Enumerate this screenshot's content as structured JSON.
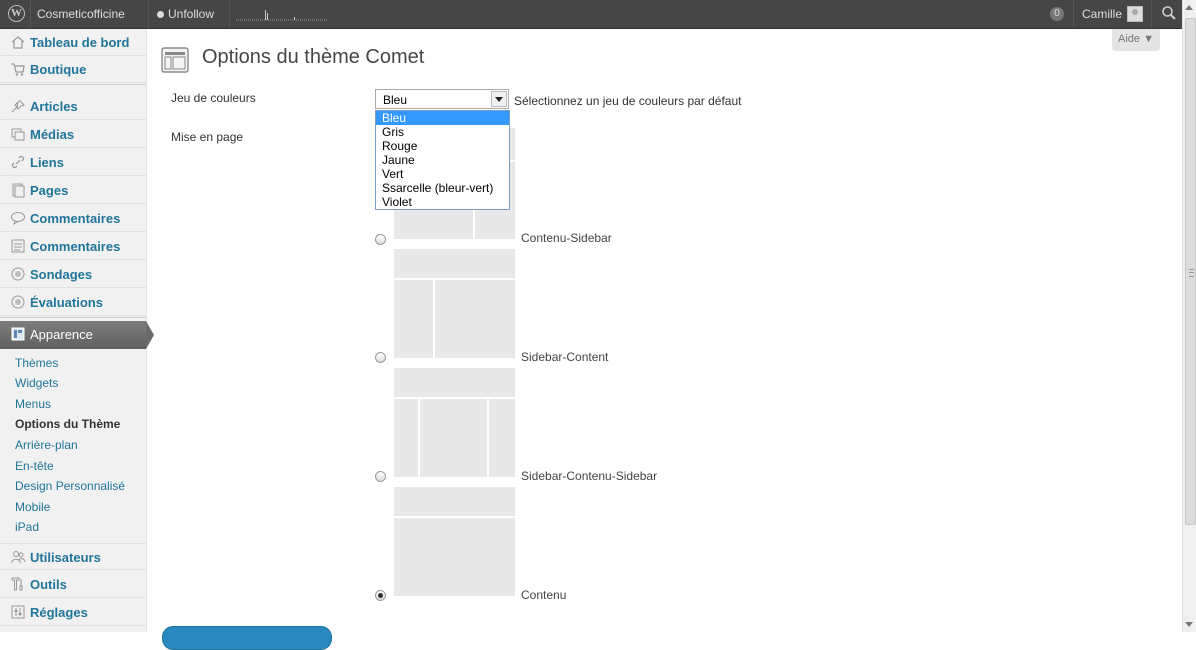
{
  "admin_bar": {
    "site_name": "Cosmeticofficine",
    "unfollow_label": "Unfollow",
    "notification_count": "0",
    "user_name": "Camille"
  },
  "help_tab": {
    "label": "Aide ▼"
  },
  "sidebar": {
    "items": [
      {
        "label": "Tableau de bord",
        "icon": "dashboard-icon"
      },
      {
        "label": "Boutique",
        "icon": "cart-icon"
      },
      {
        "label": "Articles",
        "icon": "pushpin-icon"
      },
      {
        "label": "Médias",
        "icon": "media-icon"
      },
      {
        "label": "Liens",
        "icon": "link-icon"
      },
      {
        "label": "Pages",
        "icon": "page-icon"
      },
      {
        "label": "Commentaires",
        "icon": "comment-icon"
      },
      {
        "label": "Commentaires",
        "icon": "list-icon"
      },
      {
        "label": "Sondages",
        "icon": "poll-icon"
      },
      {
        "label": "Évaluations",
        "icon": "rating-icon"
      },
      {
        "label": "Apparence",
        "icon": "appearance-icon"
      },
      {
        "label": "Utilisateurs",
        "icon": "users-icon"
      },
      {
        "label": "Outils",
        "icon": "tools-icon"
      },
      {
        "label": "Réglages",
        "icon": "settings-icon"
      }
    ],
    "submenu": [
      "Thèmes",
      "Widgets",
      "Menus",
      "Options du Thème",
      "Arrière-plan",
      "En-tête",
      "Design Personnalisé",
      "Mobile",
      "iPad"
    ],
    "current_submenu": "Options du Thème"
  },
  "page": {
    "title": "Options du thème Comet",
    "color_label": "Jeu de couleurs",
    "color_selected": "Bleu",
    "color_description": "Sélectionnez un jeu de couleurs par défaut",
    "color_options": [
      "Bleu",
      "Gris",
      "Rouge",
      "Jaune",
      "Vert",
      "Ssarcelle (bleur-vert)",
      "Violet"
    ],
    "layout_label": "Mise en page",
    "layouts": [
      {
        "label": "Contenu-Sidebar",
        "checked": false
      },
      {
        "label": "Sidebar-Content",
        "checked": false
      },
      {
        "label": "Sidebar-Contenu-Sidebar",
        "checked": false
      },
      {
        "label": "Contenu",
        "checked": true
      }
    ]
  },
  "colors": {
    "admin_bar_bg": "#464646",
    "link_blue": "#21759b",
    "selection_blue": "#3399ff",
    "current_menu_bg": "#6d6d6d"
  }
}
